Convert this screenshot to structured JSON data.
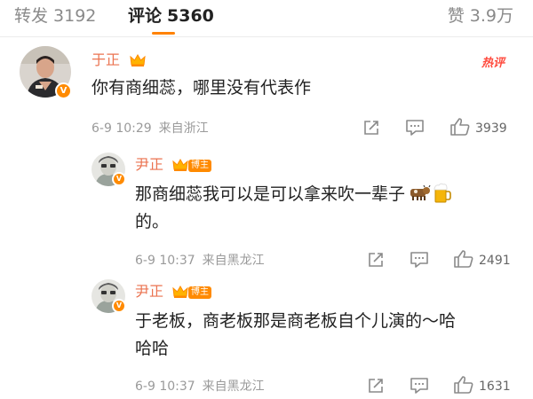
{
  "tabs": {
    "repost": {
      "label": "转发",
      "count": "3192"
    },
    "comment": {
      "label": "评论",
      "count": "5360"
    },
    "like": {
      "label": "赞",
      "count": "3.9万"
    }
  },
  "colors": {
    "accent": "#ff8200",
    "username": "#eb7350",
    "hot": "#ff4a3d",
    "meta": "#9a9a9a"
  },
  "comments": [
    {
      "username": "于正",
      "badge": "crown-icon",
      "hot_label": "热评",
      "text": "你有商细蕊，哪里没有代表作",
      "time": "6-9 10:29",
      "location": "来自浙江",
      "likes": "3939"
    },
    {
      "username": "尹正",
      "tag": "博主",
      "text_line1": "那商细蕊我可以是可以拿来吹一辈子",
      "text_line2": "的。",
      "emojis": [
        "cow-icon",
        "beer-icon"
      ],
      "time": "6-9 10:37",
      "location": "来自黑龙江",
      "likes": "2491"
    },
    {
      "username": "尹正",
      "tag": "博主",
      "text_line1": "于老板，商老板那是商老板自个儿演的～哈",
      "text_line2": "哈哈",
      "time": "6-9 10:37",
      "location": "来自黑龙江",
      "likes": "1631"
    }
  ]
}
